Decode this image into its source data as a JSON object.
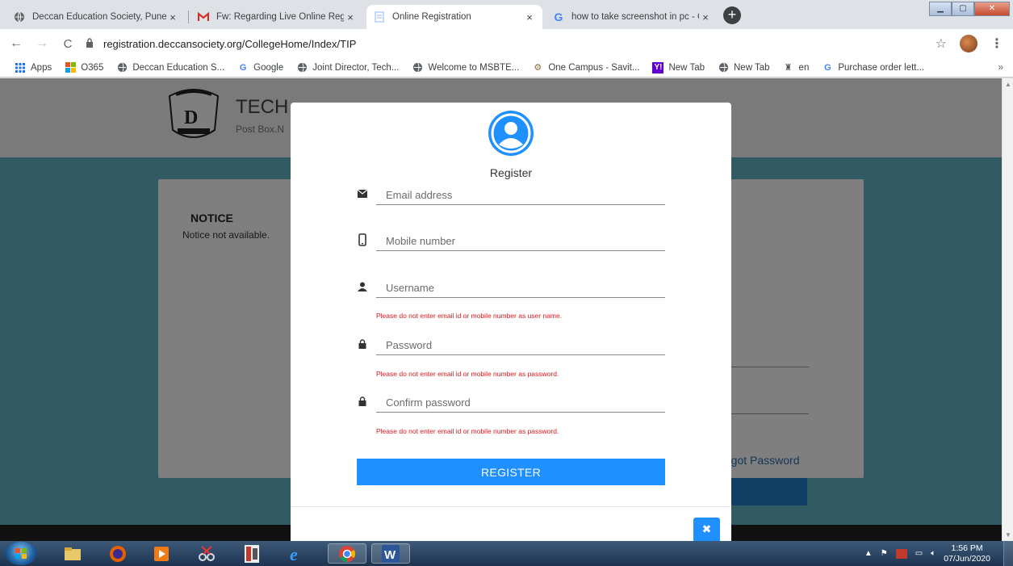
{
  "browser": {
    "tabs": [
      {
        "title": "Deccan Education Society, Pune.",
        "icon": "globe-icon",
        "active": false
      },
      {
        "title": "Fw: Regarding Live Online Regist",
        "icon": "gmail-icon",
        "active": false
      },
      {
        "title": "Online Registration",
        "icon": "page-icon",
        "active": true
      },
      {
        "title": "how to take screenshot in pc - G",
        "icon": "google-icon",
        "active": false
      }
    ],
    "close_glyph": "×",
    "new_tab_glyph": "+",
    "url": "registration.deccansociety.org/CollegeHome/Index/TIP",
    "bookmarks": [
      {
        "label": "Apps",
        "icon": "apps-grid-icon"
      },
      {
        "label": "O365",
        "icon": "office-icon"
      },
      {
        "label": "Deccan Education S...",
        "icon": "globe-icon"
      },
      {
        "label": "Google",
        "icon": "google-icon"
      },
      {
        "label": "Joint Director, Tech...",
        "icon": "globe-icon"
      },
      {
        "label": "Welcome to MSBTE...",
        "icon": "globe-icon"
      },
      {
        "label": "One Campus - Savit...",
        "icon": "university-icon"
      },
      {
        "label": "New Tab",
        "icon": "yahoo-icon"
      },
      {
        "label": "New Tab",
        "icon": "globe-icon"
      },
      {
        "label": "en",
        "icon": "emblem-icon"
      },
      {
        "label": "Purchase order lett...",
        "icon": "google-icon"
      }
    ],
    "bookmarks_more": "»"
  },
  "page": {
    "site_title": "TECH",
    "site_subtitle": "Post Box.N",
    "notice_title": "NOTICE",
    "notice_text": "Notice not available.",
    "forgot_password": "rgot Password"
  },
  "modal": {
    "title": "Register",
    "fields": [
      {
        "name": "email",
        "placeholder": "Email address",
        "icon": "envelope-icon",
        "hint": ""
      },
      {
        "name": "mobile",
        "placeholder": "Mobile number",
        "icon": "mobile-phone-icon",
        "hint": ""
      },
      {
        "name": "username",
        "placeholder": "Username",
        "icon": "user-icon",
        "hint": "Please do not enter email id or mobile number as user name."
      },
      {
        "name": "password",
        "placeholder": "Password",
        "icon": "lock-icon",
        "hint": "Please do not enter email id or mobile number as password."
      },
      {
        "name": "confirm_password",
        "placeholder": "Confirm password",
        "icon": "lock-icon",
        "hint": "Please do not enter email id or mobile number as password."
      }
    ],
    "register_label": "REGISTER",
    "close_glyph": "✖",
    "accent": "#1e90ff",
    "hint_color": "#e0191e"
  },
  "taskbar": {
    "time": "1:56 PM",
    "date": "07/Jun/2020"
  }
}
